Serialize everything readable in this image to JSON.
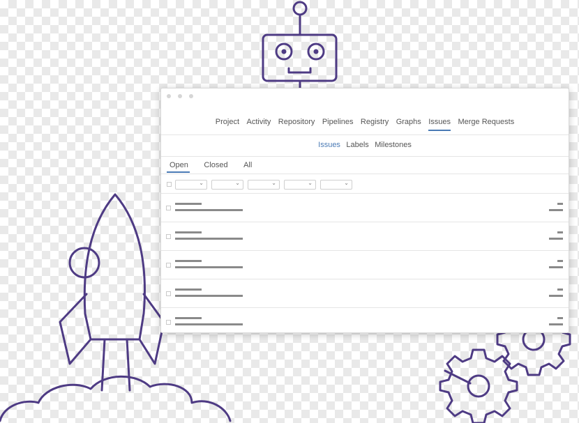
{
  "nav": {
    "items": [
      {
        "label": "Project"
      },
      {
        "label": "Activity"
      },
      {
        "label": "Repository"
      },
      {
        "label": "Pipelines"
      },
      {
        "label": "Registry"
      },
      {
        "label": "Graphs"
      },
      {
        "label": "Issues",
        "active": true
      },
      {
        "label": "Merge Requests"
      }
    ]
  },
  "subnav": {
    "items": [
      {
        "label": "Issues",
        "active": true
      },
      {
        "label": "Labels"
      },
      {
        "label": "Milestones"
      }
    ]
  },
  "tabs": {
    "items": [
      {
        "label": "Open",
        "active": true
      },
      {
        "label": "Closed"
      },
      {
        "label": "All"
      }
    ]
  },
  "filters": {
    "dropdown_count": 5,
    "chevron_icon": "chevron-down-icon"
  },
  "issues": {
    "row_count": 5
  },
  "colors": {
    "accent": "#4a7ab5",
    "illustration_stroke": "#4e3b84"
  },
  "illustrations": [
    "robot-illustration",
    "rocket-illustration",
    "gears-illustration"
  ]
}
